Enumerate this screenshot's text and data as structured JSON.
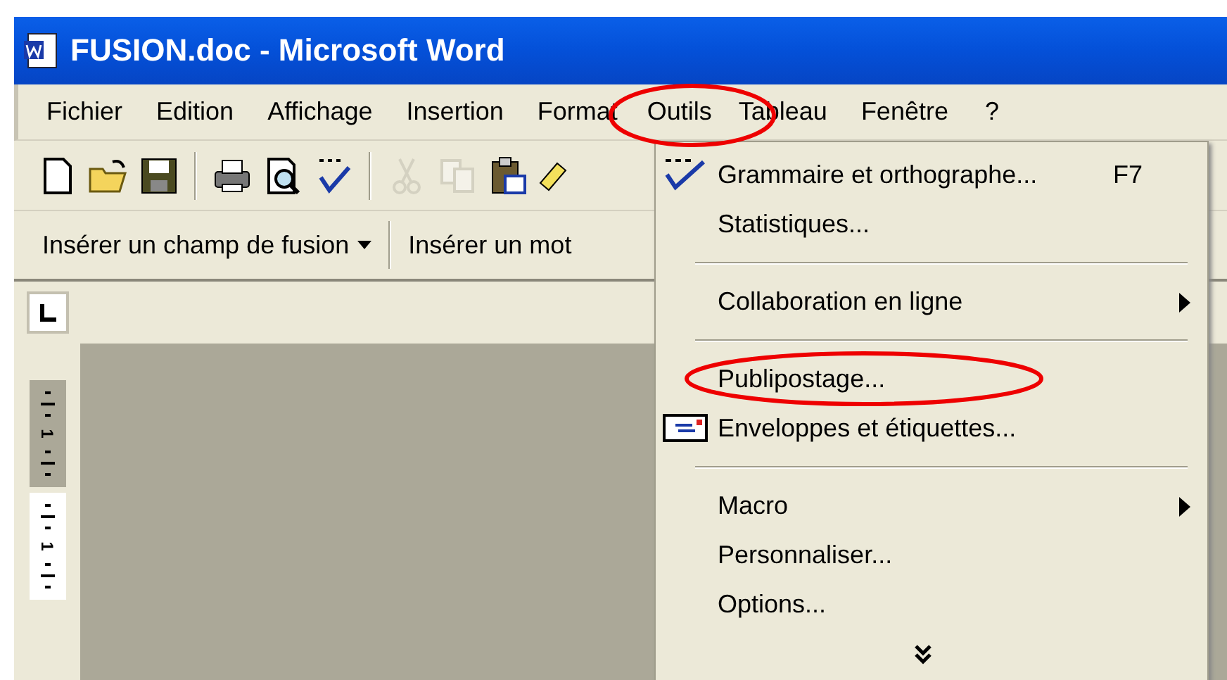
{
  "window": {
    "title": "FUSION.doc - Microsoft Word"
  },
  "menubar": [
    {
      "label": "Fichier",
      "selected": false
    },
    {
      "label": "Edition",
      "selected": false
    },
    {
      "label": "Affichage",
      "selected": false
    },
    {
      "label": "Insertion",
      "selected": false
    },
    {
      "label": "Format",
      "selected": false
    },
    {
      "label": "Outils",
      "selected": true
    },
    {
      "label": "Tableau",
      "selected": false
    },
    {
      "label": "Fenêtre",
      "selected": false
    },
    {
      "label": "?",
      "selected": false
    }
  ],
  "toolbar": [
    {
      "kind": "new",
      "disabled": false
    },
    {
      "kind": "open",
      "disabled": false
    },
    {
      "kind": "save",
      "disabled": false
    },
    {
      "kind": "sep"
    },
    {
      "kind": "print",
      "disabled": false
    },
    {
      "kind": "preview",
      "disabled": false
    },
    {
      "kind": "spelling",
      "disabled": false
    },
    {
      "kind": "sep"
    },
    {
      "kind": "cut",
      "disabled": true
    },
    {
      "kind": "copy",
      "disabled": true
    },
    {
      "kind": "paste",
      "disabled": false
    },
    {
      "kind": "brush",
      "disabled": false
    }
  ],
  "merge_toolbar": {
    "items": [
      {
        "label": "Insérer un champ de fusion",
        "dropdown": true
      },
      {
        "label": "Insérer un mot",
        "dropdown": false
      }
    ]
  },
  "vertical_ruler": {
    "labels": [
      "1",
      "1"
    ]
  },
  "menu": {
    "items": [
      {
        "kind": "item",
        "label": "Grammaire et orthographe...",
        "shortcut": "F7",
        "submenu": false,
        "highlighted": false
      },
      {
        "kind": "item",
        "label": "Statistiques...",
        "submenu": false,
        "highlighted": false
      },
      {
        "kind": "separator"
      },
      {
        "kind": "item",
        "label": "Collaboration en ligne",
        "submenu": true,
        "highlighted": false
      },
      {
        "kind": "separator"
      },
      {
        "kind": "item",
        "label": "Publipostage...",
        "submenu": false,
        "highlighted": true
      },
      {
        "kind": "item",
        "label": "Enveloppes et étiquettes...",
        "submenu": false,
        "highlighted": false
      },
      {
        "kind": "separator"
      },
      {
        "kind": "item",
        "label": "Macro",
        "submenu": true,
        "highlighted": false
      },
      {
        "kind": "item",
        "label": "Personnaliser...",
        "submenu": false,
        "highlighted": false
      },
      {
        "kind": "item",
        "label": "Options...",
        "submenu": false,
        "highlighted": false
      },
      {
        "kind": "expand"
      }
    ]
  }
}
